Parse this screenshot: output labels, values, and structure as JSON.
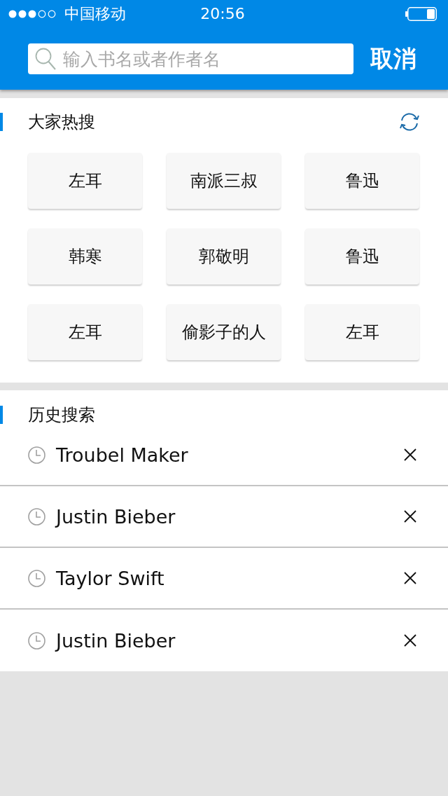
{
  "status_bar": {
    "carrier": "中国移动",
    "time": "20:56"
  },
  "search": {
    "placeholder": "输入书名或者作者名",
    "cancel": "取消"
  },
  "hot_search": {
    "title": "大家热搜",
    "tags": [
      "左耳",
      "南派三叔",
      "鲁迅",
      "韩寒",
      "郭敬明",
      "鲁迅",
      "左耳",
      "偷影子的人",
      "左耳"
    ]
  },
  "history": {
    "title": "历史搜索",
    "items": [
      "Troubel Maker",
      "Justin Bieber",
      "Taylor Swift",
      "Justin Bieber"
    ]
  }
}
